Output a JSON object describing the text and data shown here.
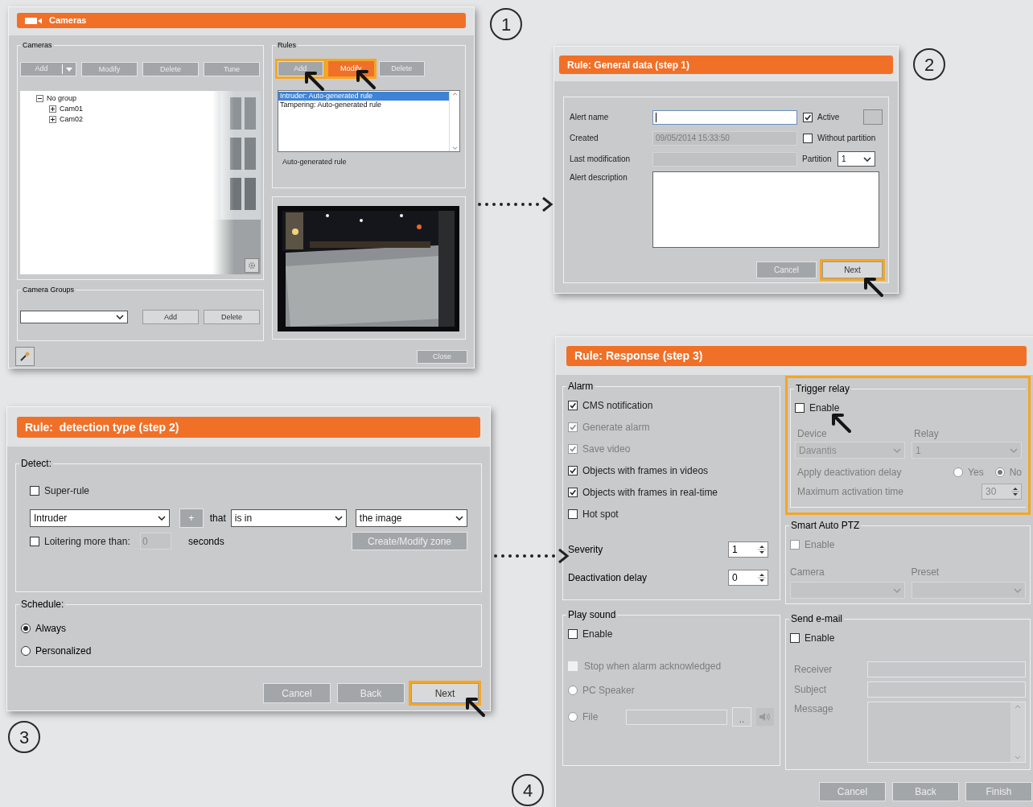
{
  "cameras_window": {
    "title": "Cameras",
    "step": "1",
    "cameras": {
      "label": "Cameras",
      "buttons": [
        {
          "label": "Add",
          "kind": "split",
          "disabled": true
        },
        {
          "label": "Modify",
          "kind": "plain",
          "disabled": true
        },
        {
          "label": "Delete",
          "kind": "plain",
          "disabled": true
        },
        {
          "label": "Tune",
          "kind": "plain",
          "disabled": true
        }
      ],
      "tree": [
        {
          "label": "No group",
          "expanded": true,
          "children": [
            {
              "label": "Cam01",
              "expanded": false
            },
            {
              "label": "Cam02",
              "expanded": false
            }
          ]
        }
      ]
    },
    "rules": {
      "label": "Rules",
      "buttons": [
        {
          "label": "Add",
          "highlighted": true,
          "filled": false
        },
        {
          "label": "Modify",
          "highlighted": true,
          "filled": true
        },
        {
          "label": "Delete",
          "highlighted": false,
          "filled": false
        }
      ],
      "items": [
        {
          "label": "Intruder: Auto-generated rule",
          "selected": true
        },
        {
          "label": "Tampering: Auto-generated rule",
          "selected": false
        }
      ],
      "description": "Auto-generated rule"
    },
    "camera_groups": {
      "label": "Camera Groups",
      "buttons": [
        {
          "label": "Add",
          "disabled": false
        },
        {
          "label": "Delete",
          "disabled": false
        }
      ]
    },
    "close_button": {
      "label": "Close",
      "disabled": true
    }
  },
  "general_data_window": {
    "title": "Rule: General data (step 1)",
    "step": "2",
    "alert_name": {
      "label": "Alert name"
    },
    "active": {
      "label": "Active",
      "checked": true
    },
    "created": {
      "label": "Created",
      "value": "09/05/2014 15:33:50"
    },
    "without_partition": {
      "label": "Without partition",
      "checked": false
    },
    "last_modification": {
      "label": "Last modification"
    },
    "partition": {
      "label": "Partition",
      "value": "1"
    },
    "alert_description": {
      "label": "Alert description"
    },
    "buttons": [
      {
        "label": "Cancel",
        "disabled": true,
        "highlighted": false
      },
      {
        "label": "Next",
        "disabled": false,
        "highlighted": true
      }
    ]
  },
  "detection_type_window": {
    "title": "Rule:  detection type (step 2)",
    "step": "3",
    "detect": {
      "label": "Detect:",
      "super_rule": {
        "label": "Super-rule",
        "checked": false
      },
      "object": "Intruder",
      "add_button": "+",
      "connector": "that",
      "condition": "is in",
      "zone": "the image",
      "loitering": {
        "label": "Loitering more than:",
        "checked": false,
        "value": "0",
        "unit": "seconds"
      },
      "zone_button": "Create/Modify zone"
    },
    "schedule": {
      "label": "Schedule:",
      "options": [
        {
          "label": "Always",
          "selected": true
        },
        {
          "label": "Personalized",
          "selected": false
        }
      ]
    },
    "buttons": [
      {
        "label": "Cancel",
        "disabled": true,
        "highlighted": false
      },
      {
        "label": "Back",
        "disabled": true,
        "highlighted": false
      },
      {
        "label": "Next",
        "disabled": false,
        "highlighted": true
      }
    ]
  },
  "response_window": {
    "title": "Rule: Response (step 3)",
    "step": "4",
    "alarm": {
      "label": "Alarm",
      "options": [
        {
          "label": "CMS notification",
          "checked": true,
          "disabled": false
        },
        {
          "label": "Generate alarm",
          "checked": true,
          "disabled": true
        },
        {
          "label": "Save video",
          "checked": true,
          "disabled": true
        },
        {
          "label": "Objects with frames in videos",
          "checked": true,
          "disabled": false
        },
        {
          "label": "Objects with frames in real-time",
          "checked": true,
          "disabled": false
        },
        {
          "label": "Hot spot",
          "checked": false,
          "disabled": false
        }
      ],
      "severity": {
        "label": "Severity",
        "value": "1"
      },
      "deactivation_delay": {
        "label": "Deactivation delay",
        "value": "0"
      }
    },
    "trigger_relay": {
      "label": "Trigger relay",
      "highlighted": true,
      "enable": {
        "label": "Enable",
        "checked": false
      },
      "device": {
        "label": "Device",
        "value": "Davantis"
      },
      "relay": {
        "label": "Relay",
        "value": "1"
      },
      "deactivation": {
        "label": "Apply deactivation delay",
        "options": [
          {
            "label": "Yes",
            "selected": false
          },
          {
            "label": "No",
            "selected": true
          }
        ]
      },
      "max_time": {
        "label": "Maximum activation time",
        "value": "30"
      }
    },
    "smart_ptz": {
      "label": "Smart Auto PTZ",
      "enable": {
        "label": "Enable",
        "checked": false
      },
      "camera": {
        "label": "Camera"
      },
      "preset": {
        "label": "Preset"
      }
    },
    "play_sound": {
      "label": "Play sound",
      "enable": {
        "label": "Enable",
        "checked": false
      },
      "stop": {
        "label": "Stop when alarm acknowledged",
        "checked": false
      },
      "sources": [
        {
          "label": "PC Speaker",
          "selected": false
        },
        {
          "label": "File",
          "selected": false
        }
      ],
      "browse_button": ".."
    },
    "send_email": {
      "label": "Send e-mail",
      "enable": {
        "label": "Enable",
        "checked": false
      },
      "fields": [
        {
          "label": "Receiver",
          "kind": "line"
        },
        {
          "label": "Subject",
          "kind": "line"
        },
        {
          "label": "Message",
          "kind": "multiline"
        }
      ]
    },
    "buttons": [
      {
        "label": "Cancel",
        "disabled": true
      },
      {
        "label": "Back",
        "disabled": true
      },
      {
        "label": "Finish",
        "disabled": true
      }
    ]
  }
}
